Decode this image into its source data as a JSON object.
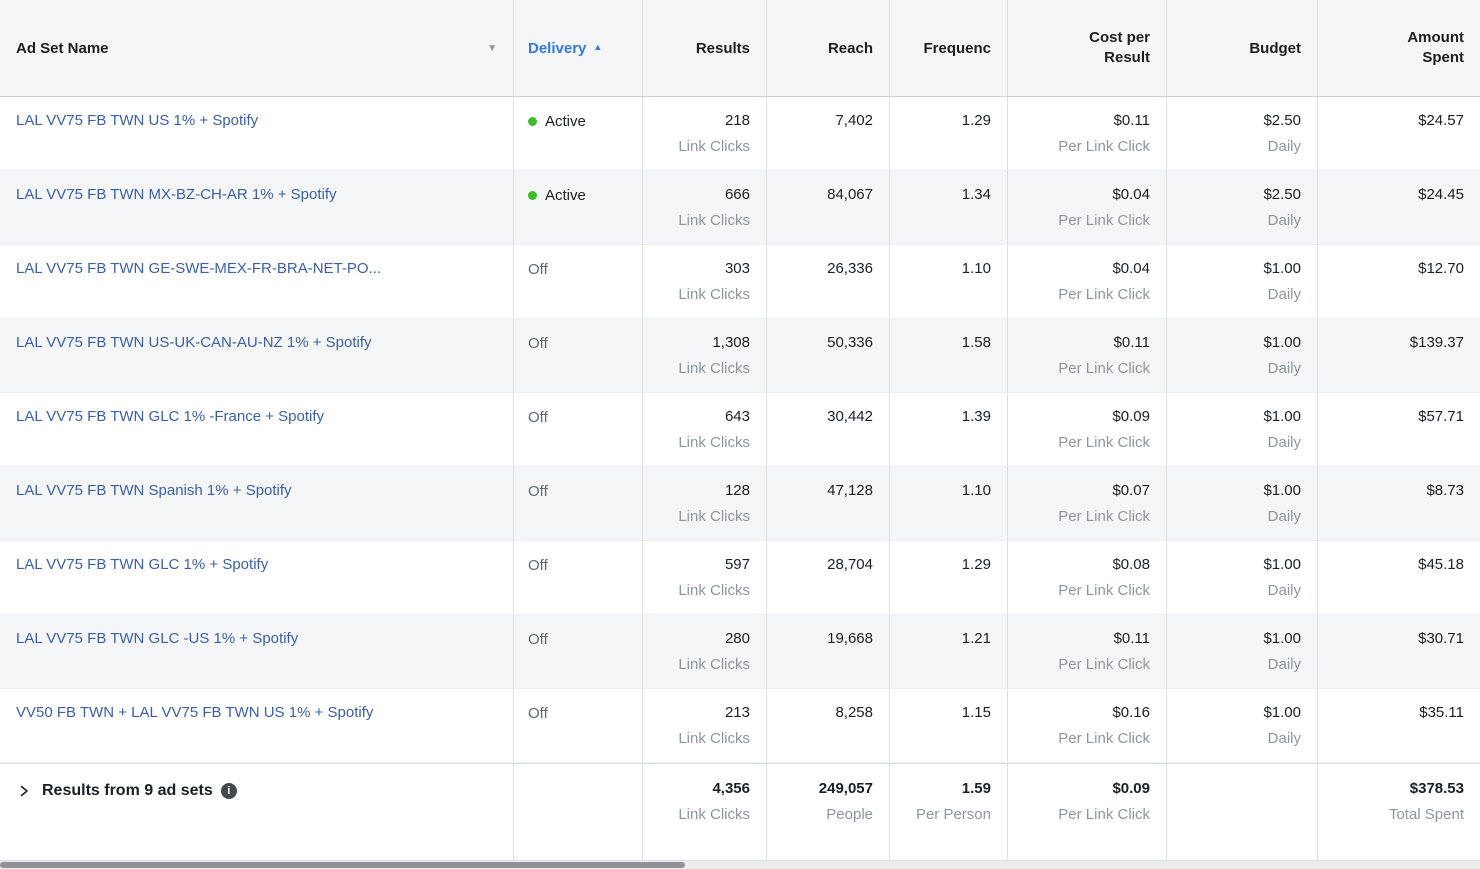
{
  "colors": {
    "link_blue": "#3b5fa8",
    "sorted_header_blue": "#3578e5",
    "active_dot_green": "#42bb29",
    "primary_text": "#1c1e21",
    "secondary_text": "#90949c",
    "off_text": "#606770",
    "header_bg": "#f5f6f7",
    "alt_row_bg": "#f5f6f7"
  },
  "columns": [
    {
      "id": "ad_set_name",
      "label": "Ad Set Name"
    },
    {
      "id": "delivery",
      "label": "Delivery",
      "sorted": "ascending"
    },
    {
      "id": "results",
      "label": "Results"
    },
    {
      "id": "reach",
      "label": "Reach"
    },
    {
      "id": "frequency",
      "label": "Frequenc"
    },
    {
      "id": "cost_per_result",
      "label": "Cost per Result"
    },
    {
      "id": "budget",
      "label": "Budget"
    },
    {
      "id": "amount_spent",
      "label": "Amount Spent"
    }
  ],
  "icons": {
    "adset_header_caret": "▼",
    "delivery_sort_arrow": "▲",
    "info_glyph": "i"
  },
  "rows": [
    {
      "name": "LAL VV75 FB TWN US 1% + Spotify",
      "delivery": "Active",
      "delivery_state": "active",
      "results": "218",
      "results_label": "Link Clicks",
      "reach": "7,402",
      "frequency": "1.29",
      "cost": "$0.11",
      "cost_label": "Per Link Click",
      "budget": "$2.50",
      "budget_label": "Daily",
      "amount": "$24.57"
    },
    {
      "name": "LAL VV75 FB TWN MX-BZ-CH-AR 1% + Spotify",
      "delivery": "Active",
      "delivery_state": "active",
      "results": "666",
      "results_label": "Link Clicks",
      "reach": "84,067",
      "frequency": "1.34",
      "cost": "$0.04",
      "cost_label": "Per Link Click",
      "budget": "$2.50",
      "budget_label": "Daily",
      "amount": "$24.45"
    },
    {
      "name": "LAL VV75 FB TWN GE-SWE-MEX-FR-BRA-NET-PO...",
      "delivery": "Off",
      "delivery_state": "off",
      "results": "303",
      "results_label": "Link Clicks",
      "reach": "26,336",
      "frequency": "1.10",
      "cost": "$0.04",
      "cost_label": "Per Link Click",
      "budget": "$1.00",
      "budget_label": "Daily",
      "amount": "$12.70"
    },
    {
      "name": "LAL VV75 FB TWN US-UK-CAN-AU-NZ 1% + Spotify",
      "delivery": "Off",
      "delivery_state": "off",
      "results": "1,308",
      "results_label": "Link Clicks",
      "reach": "50,336",
      "frequency": "1.58",
      "cost": "$0.11",
      "cost_label": "Per Link Click",
      "budget": "$1.00",
      "budget_label": "Daily",
      "amount": "$139.37"
    },
    {
      "name": "LAL VV75 FB TWN GLC 1% -France + Spotify",
      "delivery": "Off",
      "delivery_state": "off",
      "results": "643",
      "results_label": "Link Clicks",
      "reach": "30,442",
      "frequency": "1.39",
      "cost": "$0.09",
      "cost_label": "Per Link Click",
      "budget": "$1.00",
      "budget_label": "Daily",
      "amount": "$57.71"
    },
    {
      "name": "LAL VV75 FB TWN Spanish 1% + Spotify",
      "delivery": "Off",
      "delivery_state": "off",
      "results": "128",
      "results_label": "Link Clicks",
      "reach": "47,128",
      "frequency": "1.10",
      "cost": "$0.07",
      "cost_label": "Per Link Click",
      "budget": "$1.00",
      "budget_label": "Daily",
      "amount": "$8.73"
    },
    {
      "name": "LAL VV75 FB TWN GLC 1% + Spotify",
      "delivery": "Off",
      "delivery_state": "off",
      "results": "597",
      "results_label": "Link Clicks",
      "reach": "28,704",
      "frequency": "1.29",
      "cost": "$0.08",
      "cost_label": "Per Link Click",
      "budget": "$1.00",
      "budget_label": "Daily",
      "amount": "$45.18"
    },
    {
      "name": "LAL VV75 FB TWN GLC -US 1% + Spotify",
      "delivery": "Off",
      "delivery_state": "off",
      "results": "280",
      "results_label": "Link Clicks",
      "reach": "19,668",
      "frequency": "1.21",
      "cost": "$0.11",
      "cost_label": "Per Link Click",
      "budget": "$1.00",
      "budget_label": "Daily",
      "amount": "$30.71"
    },
    {
      "name": "VV50 FB TWN + LAL VV75 FB TWN US 1% + Spotify",
      "delivery": "Off",
      "delivery_state": "off",
      "results": "213",
      "results_label": "Link Clicks",
      "reach": "8,258",
      "frequency": "1.15",
      "cost": "$0.16",
      "cost_label": "Per Link Click",
      "budget": "$1.00",
      "budget_label": "Daily",
      "amount": "$35.11"
    }
  ],
  "footer": {
    "title": "Results from 9 ad sets",
    "results": "4,356",
    "results_label": "Link Clicks",
    "reach": "249,057",
    "reach_label": "People",
    "frequency": "1.59",
    "frequency_label": "Per Person",
    "cost": "$0.09",
    "cost_label": "Per Link Click",
    "budget": "",
    "budget_label": "",
    "amount": "$378.53",
    "amount_label": "Total Spent"
  }
}
